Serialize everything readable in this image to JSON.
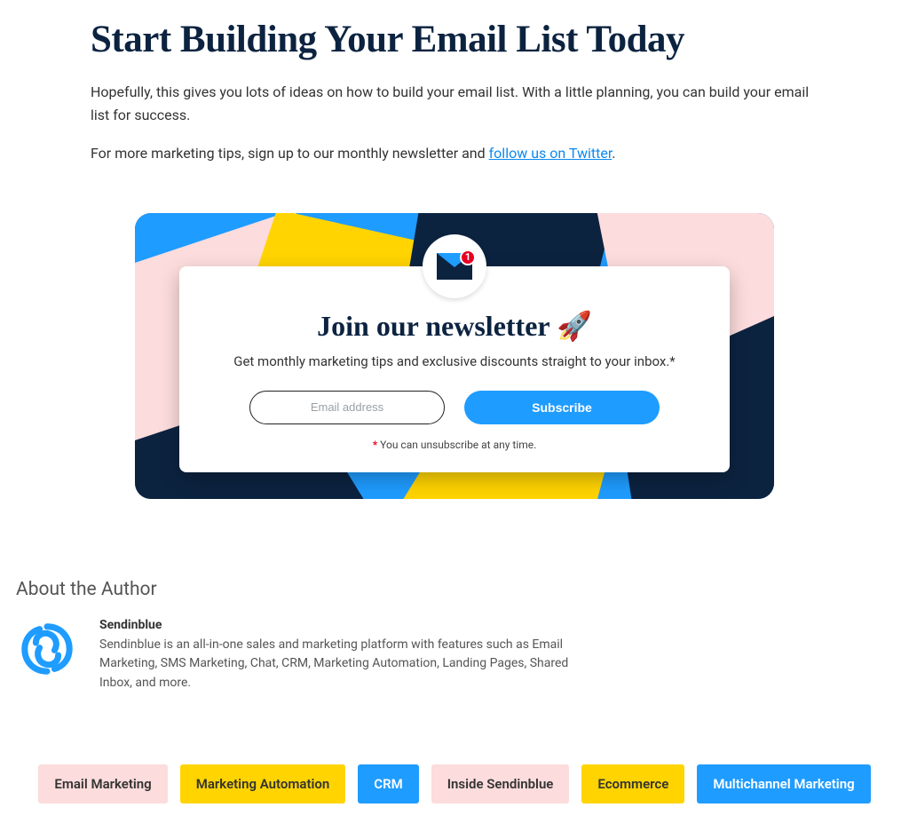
{
  "article": {
    "title": "Start Building Your Email List Today",
    "para1": "Hopefully, this gives you lots of ideas on how to build your email list. With a little planning, you can build your email list for success.",
    "para2_pre": "For more marketing tips, sign up to our monthly newsletter and ",
    "twitter_link_text": "follow us on Twitter",
    "para2_post": "."
  },
  "newsletter": {
    "badge_count": "1",
    "title": "Join our newsletter 🚀",
    "subtitle": "Get monthly marketing tips and exclusive discounts straight to your inbox.*",
    "email_placeholder": "Email address",
    "subscribe_label": "Subscribe",
    "fineprint_asterisk": "*",
    "fineprint_text": " You can unsubscribe at any time."
  },
  "author": {
    "section_heading": "About the Author",
    "name": "Sendinblue",
    "bio": "Sendinblue is an all-in-one sales and marketing platform with features such as Email Marketing, SMS Marketing, Chat, CRM, Marketing Automation, Landing Pages, Shared Inbox, and more."
  },
  "tags": [
    {
      "label": "Email Marketing",
      "variant": "pink"
    },
    {
      "label": "Marketing Automation",
      "variant": "yellow"
    },
    {
      "label": "CRM",
      "variant": "blue"
    },
    {
      "label": "Inside Sendinblue",
      "variant": "pink"
    },
    {
      "label": "Ecommerce",
      "variant": "yellow"
    },
    {
      "label": "Multichannel Marketing",
      "variant": "blue"
    }
  ],
  "colors": {
    "brand_navy": "#0c2340",
    "brand_blue": "#1f9cff",
    "brand_yellow": "#ffd400",
    "brand_pink": "#fcdcdc",
    "alert_red": "#e60023"
  }
}
